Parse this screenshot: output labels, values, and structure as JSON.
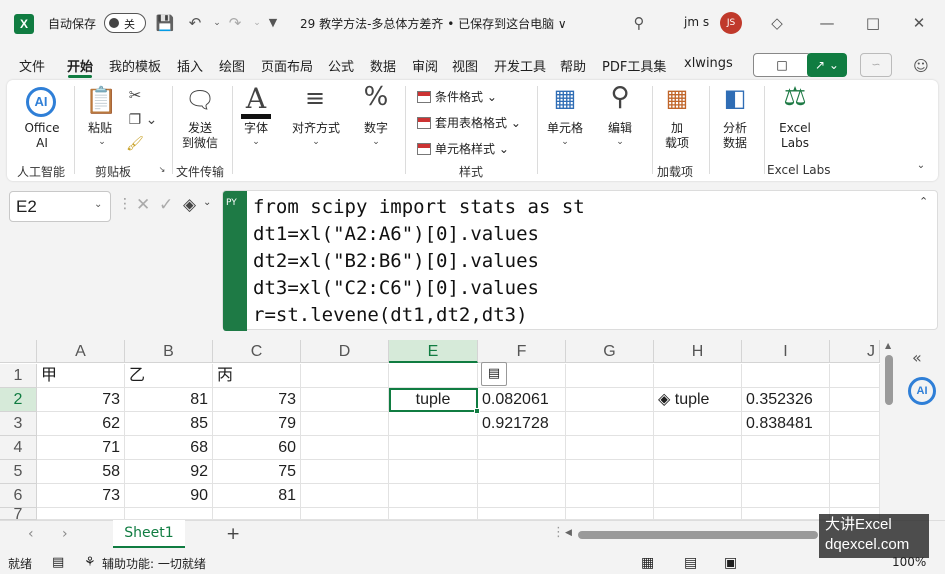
{
  "titlebar": {
    "app_icon": "X",
    "autosave_label": "自动保存",
    "autosave_state": "关",
    "doc_title": "29 教学方法-多总体方差齐 • 已保存到这台电脑 ∨",
    "user_name": "jm s",
    "avatar_initials": "JS",
    "icons": [
      "save-icon",
      "undo-icon",
      "redo-icon",
      "customize-icon",
      "search-icon",
      "diamond-icon",
      "minimize-icon",
      "maximize-icon",
      "close-icon"
    ]
  },
  "menu": {
    "tabs": [
      "文件",
      "开始",
      "我的模板",
      "插入",
      "绘图",
      "页面布局",
      "公式",
      "数据",
      "审阅",
      "视图",
      "开发工具",
      "帮助",
      "PDF工具集",
      "xlwings"
    ],
    "active": "开始"
  },
  "ribbon": {
    "office_ai": {
      "line1": "Office",
      "line2": "AI",
      "group": "人工智能"
    },
    "paste": {
      "label": "粘贴",
      "group": "剪贴板"
    },
    "send_wechat": {
      "line1": "发送",
      "line2": "到微信",
      "group": "文件传输"
    },
    "font": "字体",
    "align": "对齐方式",
    "number": "数字",
    "cond_format": "条件格式",
    "table_format": "套用表格格式",
    "cell_style": "单元格样式",
    "style_group": "样式",
    "cells": "单元格",
    "edit": "编辑",
    "addin": {
      "line1": "加",
      "line2": "载项",
      "group": "加载项"
    },
    "analyze": {
      "line1": "分析",
      "line2": "数据"
    },
    "excel_labs": {
      "line1": "Excel",
      "line2": "Labs",
      "group": "Excel Labs"
    }
  },
  "formula_bar": {
    "name_box": "E2",
    "py_tag": "PY",
    "code": [
      "from scipy import stats as st",
      "dt1=xl(\"A2:A6\")[0].values",
      "dt2=xl(\"B2:B6\")[0].values",
      "dt3=xl(\"C2:C6\")[0].values",
      "r=st.levene(dt1,dt2,dt3)"
    ]
  },
  "grid": {
    "columns": [
      "A",
      "B",
      "C",
      "D",
      "E",
      "F",
      "G",
      "H",
      "I",
      "J"
    ],
    "rows": [
      "1",
      "2",
      "3",
      "4",
      "5",
      "6",
      "7"
    ],
    "selected_cell": "E2",
    "header_row": [
      "甲",
      "乙",
      "丙"
    ],
    "data": [
      [
        73,
        81,
        73
      ],
      [
        62,
        85,
        79
      ],
      [
        71,
        68,
        60
      ],
      [
        58,
        92,
        75
      ],
      [
        73,
        90,
        81
      ]
    ],
    "e2": "tuple",
    "f2": "0.082061",
    "f3": "0.921728",
    "h2": "tuple",
    "i2": "0.352326",
    "i3": "0.838481"
  },
  "sheets": {
    "active": "Sheet1",
    "add": "+"
  },
  "statusbar": {
    "ready": "就绪",
    "accessibility": "辅助功能: 一切就绪",
    "zoom": "100%"
  },
  "watermark": {
    "line1": "大讲Excel",
    "line2": "dqexcel.com"
  },
  "colors": {
    "accent": "#107c41",
    "py": "#1e7a45",
    "ai": "#2f7fd7",
    "avatar": "#c0392b"
  }
}
